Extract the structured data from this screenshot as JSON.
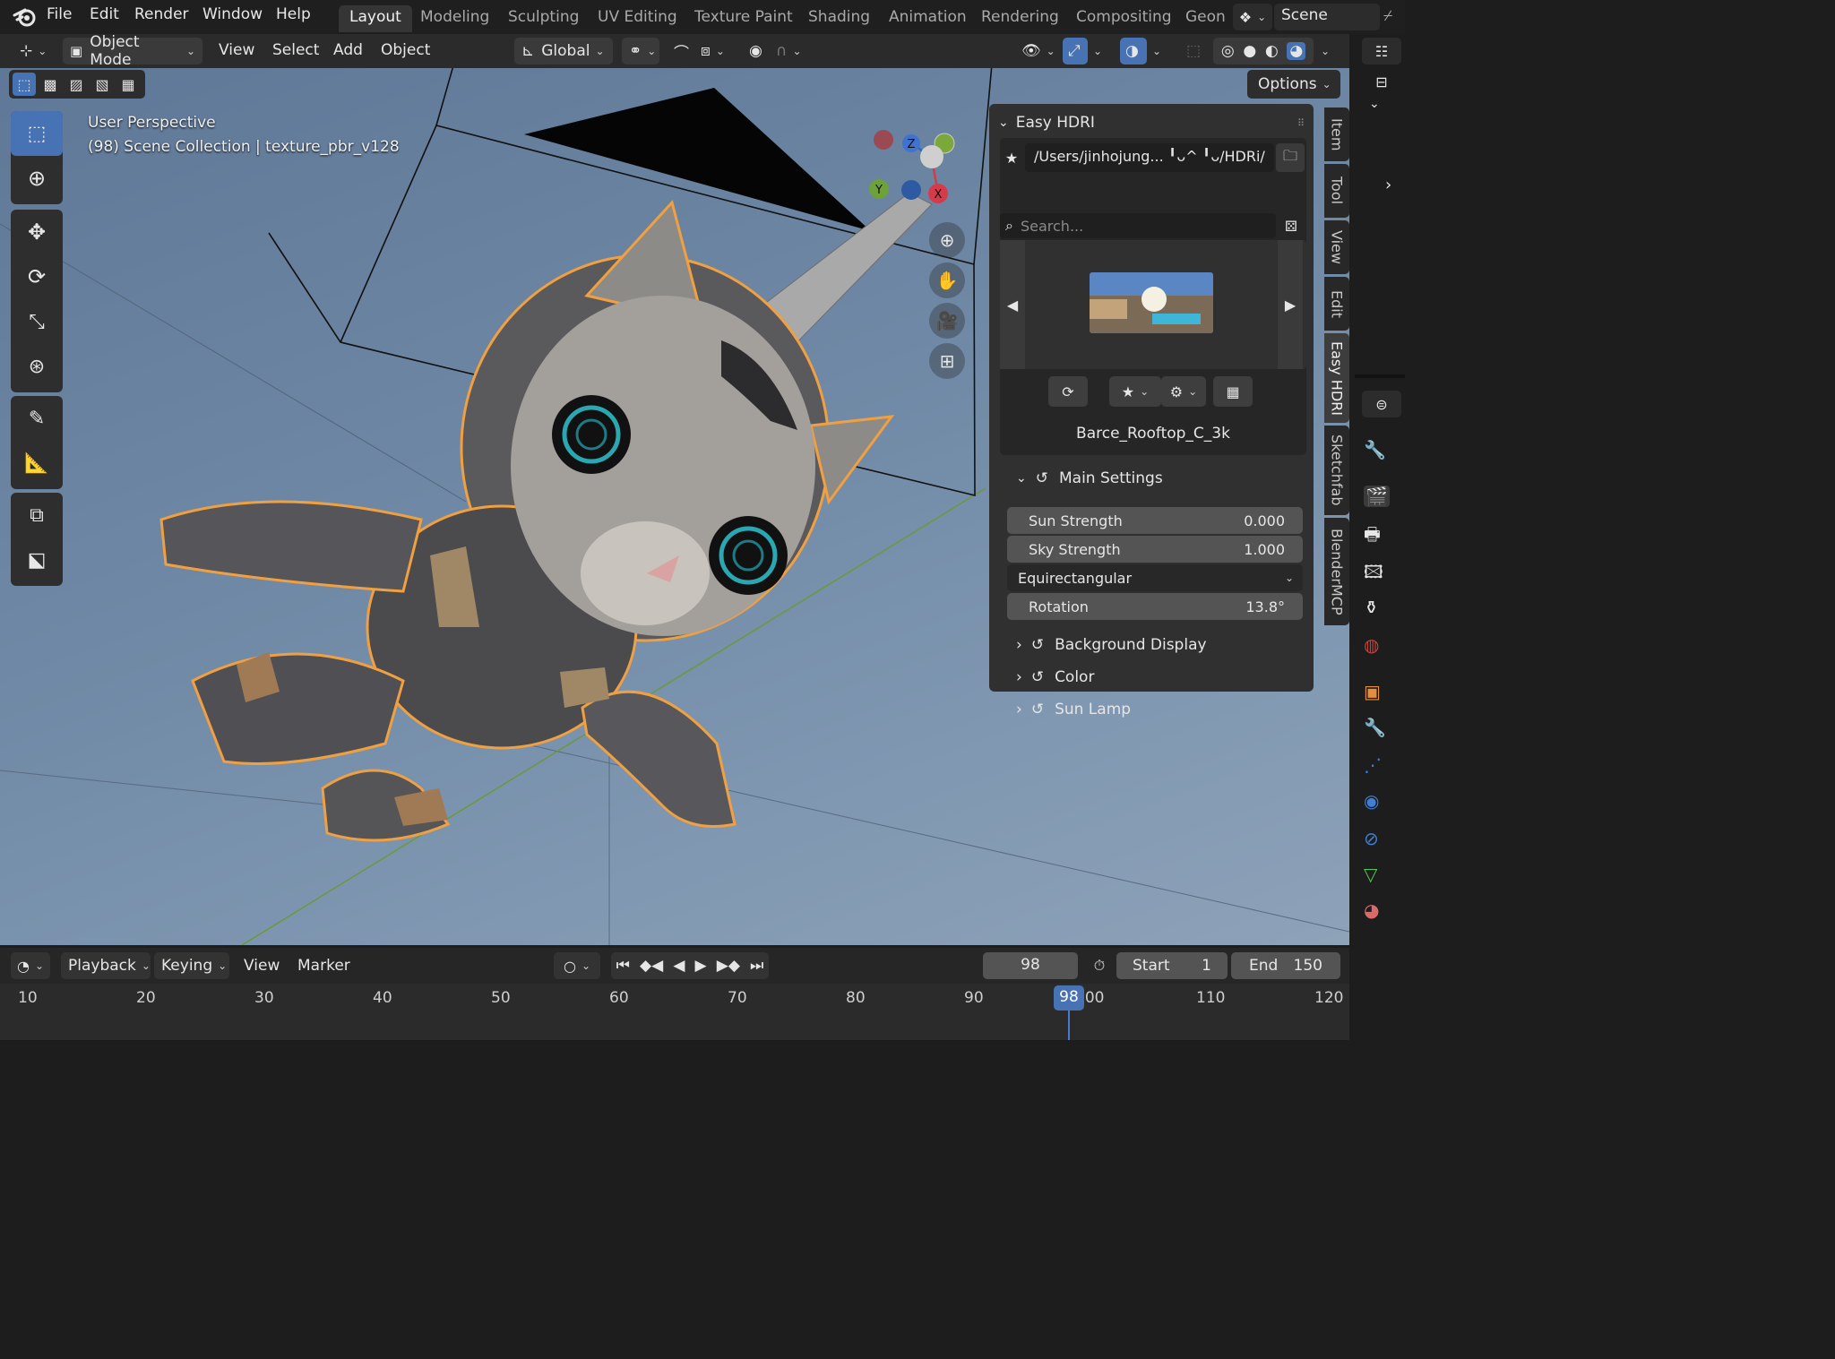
{
  "topbar": {
    "menus": [
      "File",
      "Edit",
      "Render",
      "Window",
      "Help"
    ],
    "workspaces": [
      "Layout",
      "Modeling",
      "Sculpting",
      "UV Editing",
      "Texture Paint",
      "Shading",
      "Animation",
      "Rendering",
      "Compositing",
      "Geon"
    ],
    "active_workspace": "Layout",
    "scene_label": "Scene"
  },
  "viewport": {
    "mode": "Object Mode",
    "menus": [
      "View",
      "Select",
      "Add",
      "Object"
    ],
    "orientation": "Global",
    "options_label": "Options",
    "overlay_title": "User Perspective",
    "overlay_info": "(98) Scene Collection | texture_pbr_v128",
    "gizmo_axes": [
      "Z",
      "Y",
      "X"
    ],
    "accent": "#4772b3",
    "selection_outline": "#f0a040"
  },
  "easy_hdri": {
    "title": "Easy HDRI",
    "path": "/Users/jinhojung... ╹ᴗ^ ╹ᴗ/HDRi/",
    "search_placeholder": "Search...",
    "hdri_name": "Barce_Rooftop_C_3k",
    "main_settings": {
      "label": "Main Settings",
      "fields": [
        {
          "label": "Sun Strength",
          "value": "0.000"
        },
        {
          "label": "Sky Strength",
          "value": "1.000"
        }
      ],
      "projection": "Equirectangular",
      "rotation": {
        "label": "Rotation",
        "value": "13.8°"
      }
    },
    "subsections": [
      "Background Display",
      "Color",
      "Sun Lamp"
    ]
  },
  "sidebar_tabs": [
    "Item",
    "Tool",
    "View",
    "Edit",
    "Easy HDRI",
    "Sketchfab",
    "BlenderMCP"
  ],
  "active_sidebar_tab": "Easy HDRI",
  "timeline": {
    "menus": [
      "Playback",
      "Keying",
      "View",
      "Marker"
    ],
    "current_frame": "98",
    "start_label": "Start",
    "start_value": "1",
    "end_label": "End",
    "end_value": "150",
    "ruler_ticks": [
      "10",
      "20",
      "30",
      "40",
      "50",
      "60",
      "70",
      "80",
      "90",
      "100",
      "110",
      "120"
    ],
    "playhead_label": "98"
  }
}
